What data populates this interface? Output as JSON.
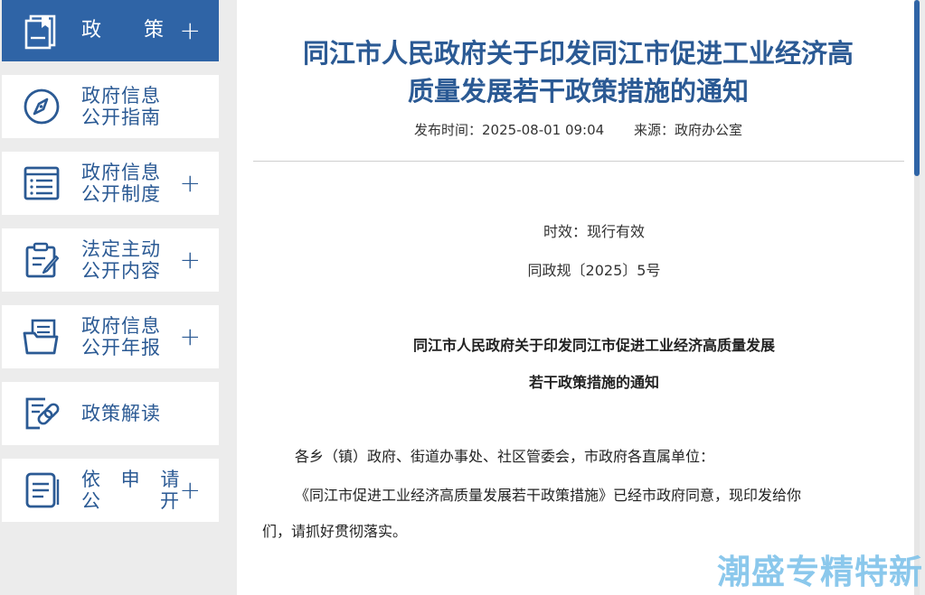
{
  "sidebar": {
    "items": [
      {
        "label": "政策",
        "icon": "document-stack-icon",
        "expandable": true,
        "active": true
      },
      {
        "line1": "政府信息",
        "line2": "公开指南",
        "icon": "compass-icon",
        "expandable": false
      },
      {
        "line1": "政府信息",
        "line2": "公开制度",
        "icon": "list-icon",
        "expandable": true
      },
      {
        "line1": "法定主动",
        "line2": "公开内容",
        "icon": "clipboard-edit-icon",
        "expandable": true
      },
      {
        "line1": "政府信息",
        "line2": "公开年报",
        "icon": "folder-document-icon",
        "expandable": true
      },
      {
        "label": "政策解读",
        "icon": "link-document-icon",
        "expandable": false
      },
      {
        "line1": "依 申 请",
        "line2": "公　　开",
        "icon": "notepad-icon",
        "expandable": true
      }
    ],
    "plus_symbol": "+"
  },
  "article": {
    "title_line1": "同江市人民政府关于印发同江市促进工业经济高",
    "title_line2": "质量发展若干政策措施的通知",
    "publish_time": "发布时间：2025-08-01 09:04",
    "source": "来源：政府办公室",
    "validity": "时效：现行有效",
    "doc_number": "同政规〔2025〕5号",
    "heading_line1": "同江市人民政府关于印发同江市促进工业经济高质量发展",
    "heading_line2": "若干政策措施的通知",
    "salutation": "各乡（镇）政府、街道办事处、社区管委会，市政府各直属单位：",
    "body_line1": "《同江市促进工业经济高质量发展若干政策措施》已经市政府同意，现印发给你",
    "body_line2": "们，请抓好贯彻落实。"
  },
  "watermark": "潮盛专精特新",
  "colors": {
    "accent": "#2f64a6",
    "title": "#2b5a94",
    "watermark": "#7fc3ea"
  }
}
